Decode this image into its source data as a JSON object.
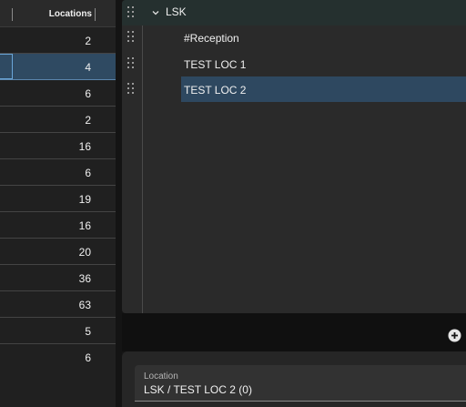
{
  "table": {
    "column_header": "Locations",
    "rows": [
      {
        "value": "2"
      },
      {
        "value": "4"
      },
      {
        "value": "6"
      },
      {
        "value": "2"
      },
      {
        "value": "16"
      },
      {
        "value": "6"
      },
      {
        "value": "19"
      },
      {
        "value": "16"
      },
      {
        "value": "20"
      },
      {
        "value": "36"
      },
      {
        "value": "63"
      },
      {
        "value": "5"
      },
      {
        "value": "6"
      }
    ],
    "selected_index": 1
  },
  "tree": {
    "parent": {
      "label": "LSK",
      "expanded": true
    },
    "children": [
      {
        "label": "#Reception"
      },
      {
        "label": "TEST LOC 1"
      },
      {
        "label": "TEST LOC 2",
        "selected": true
      }
    ]
  },
  "location": {
    "label": "Location",
    "value": "LSK / TEST LOC 2 (0)"
  },
  "icons": {
    "drag": "drag-handle-icon",
    "expand": "chevron-down-icon",
    "add": "add-circle-icon"
  },
  "colors": {
    "selected_row": "#2f4a62",
    "selected_tree": "#2e4860",
    "panel": "#2a2a2a"
  }
}
